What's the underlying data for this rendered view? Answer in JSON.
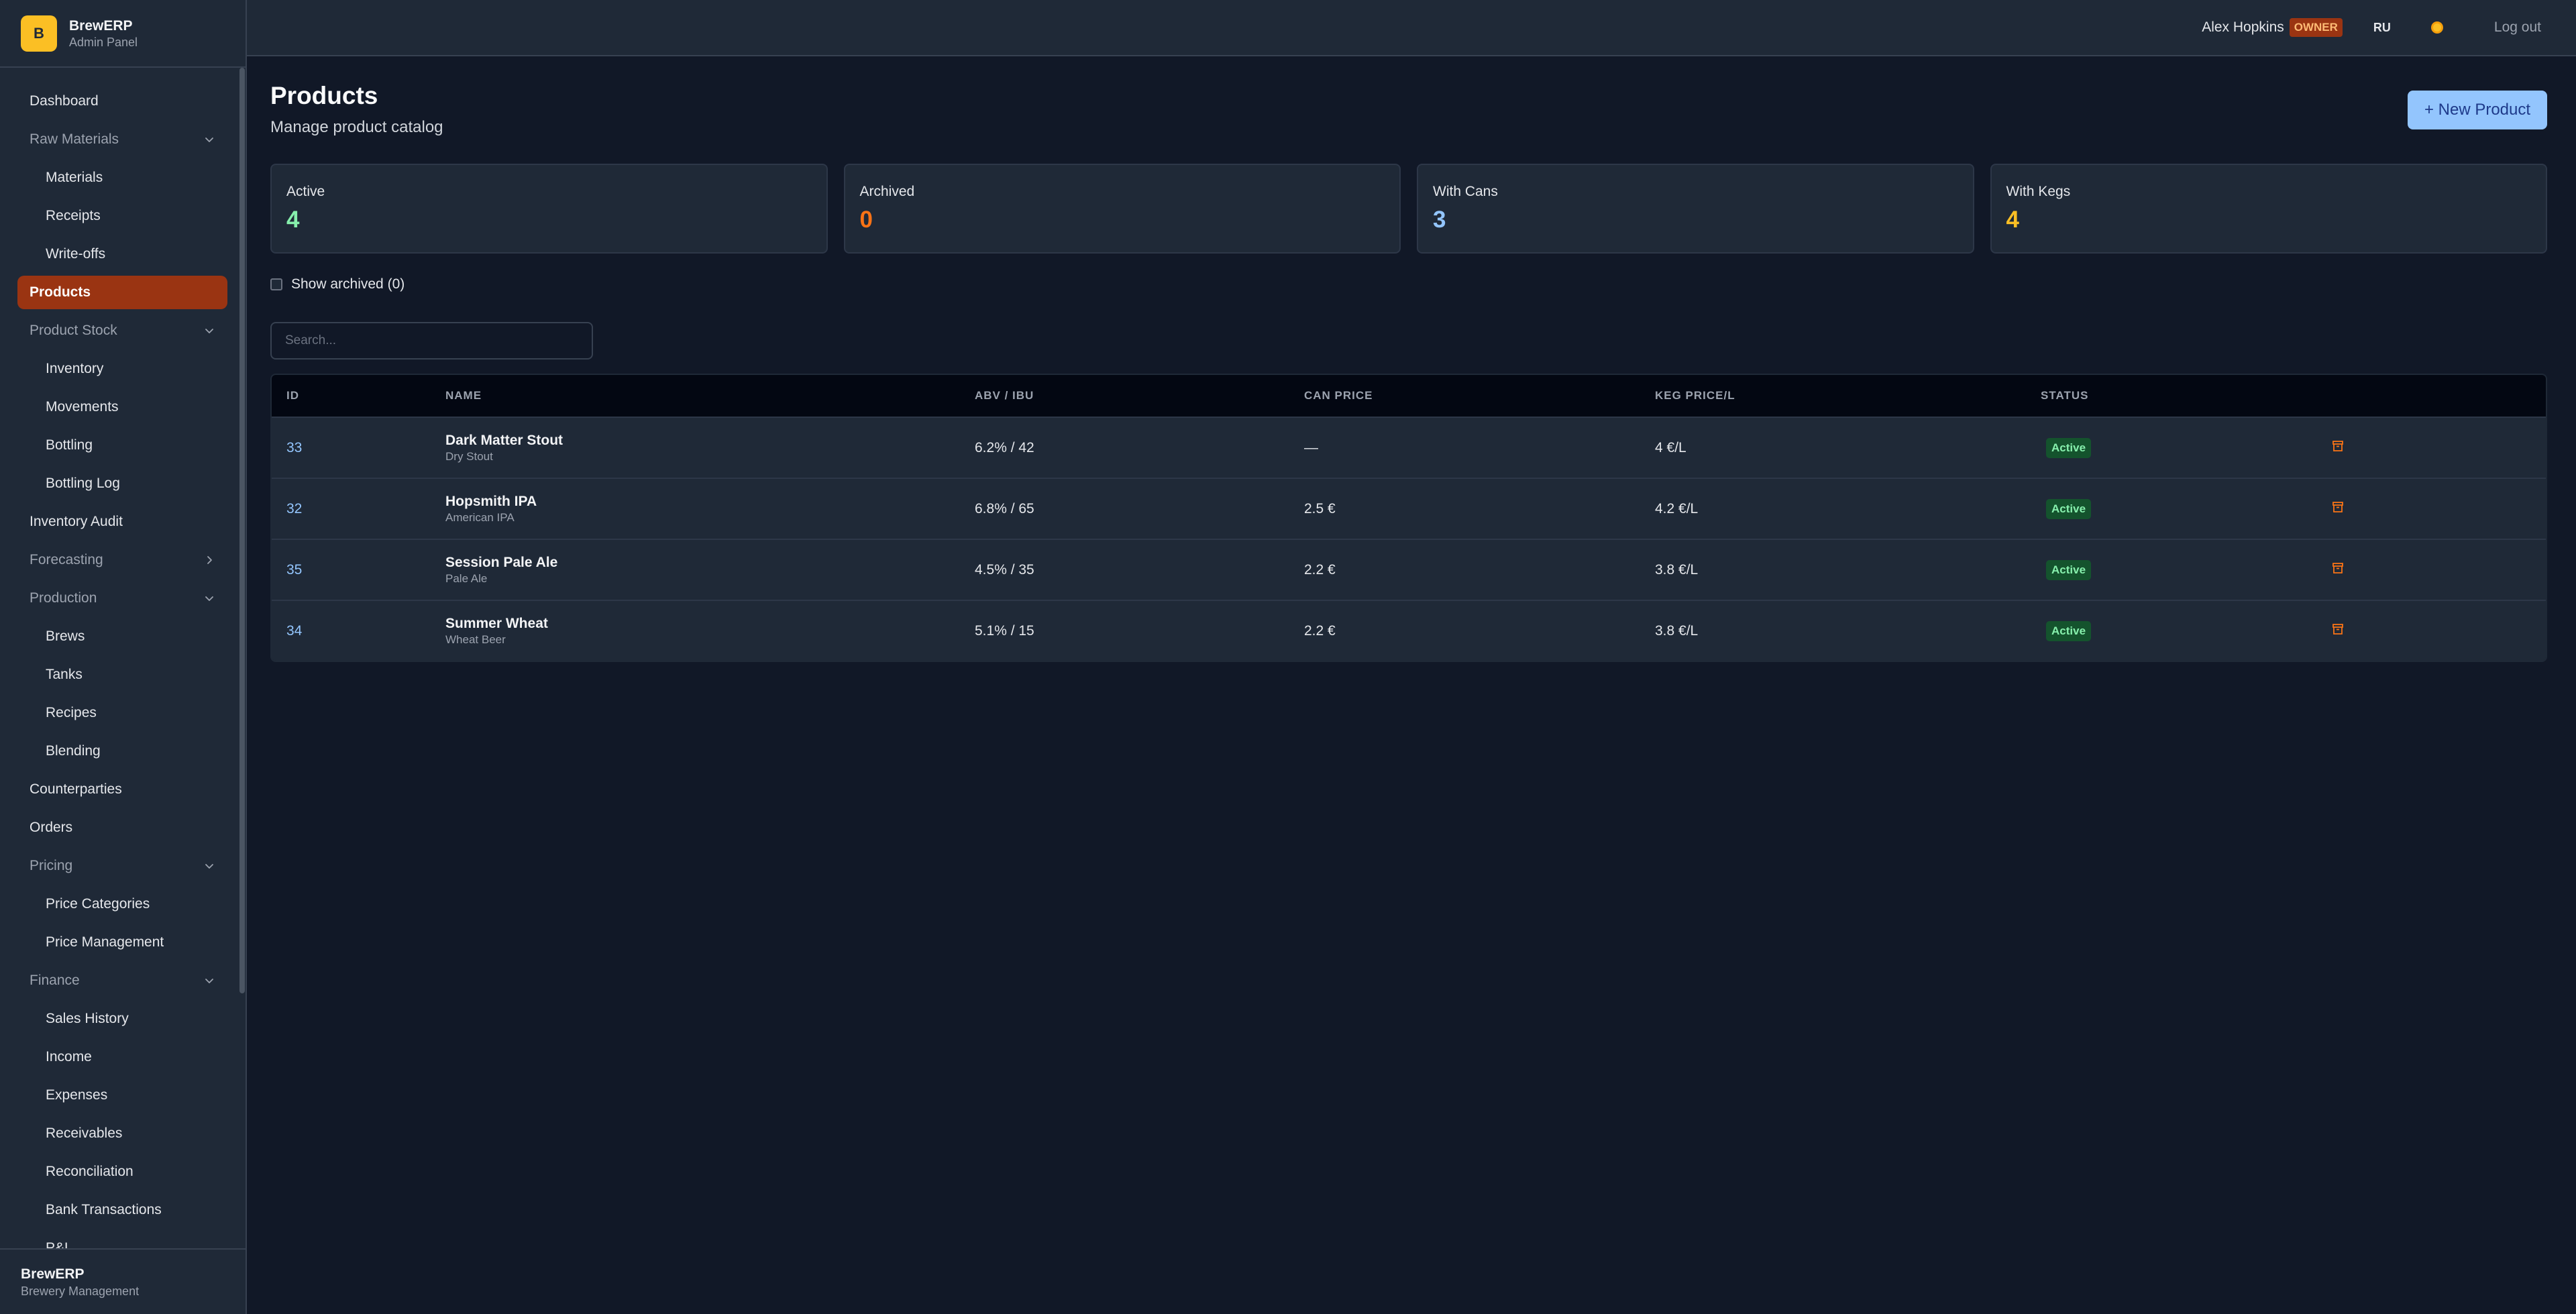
{
  "brand": {
    "initial": "B",
    "name": "BrewERP",
    "subtitle": "Admin Panel"
  },
  "sidebar": {
    "items": [
      {
        "label": "Dashboard",
        "kind": "item"
      },
      {
        "label": "Raw Materials",
        "kind": "group",
        "chevron": "chevron-down-icon"
      },
      {
        "label": "Materials",
        "kind": "sub"
      },
      {
        "label": "Receipts",
        "kind": "sub"
      },
      {
        "label": "Write-offs",
        "kind": "sub"
      },
      {
        "label": "Products",
        "kind": "item",
        "active": true
      },
      {
        "label": "Product Stock",
        "kind": "group",
        "chevron": "chevron-down-icon"
      },
      {
        "label": "Inventory",
        "kind": "sub"
      },
      {
        "label": "Movements",
        "kind": "sub"
      },
      {
        "label": "Bottling",
        "kind": "sub"
      },
      {
        "label": "Bottling Log",
        "kind": "sub"
      },
      {
        "label": "Inventory Audit",
        "kind": "item"
      },
      {
        "label": "Forecasting",
        "kind": "group",
        "chevron": "chevron-right-icon"
      },
      {
        "label": "Production",
        "kind": "group",
        "chevron": "chevron-down-icon"
      },
      {
        "label": "Brews",
        "kind": "sub"
      },
      {
        "label": "Tanks",
        "kind": "sub"
      },
      {
        "label": "Recipes",
        "kind": "sub"
      },
      {
        "label": "Blending",
        "kind": "sub"
      },
      {
        "label": "Counterparties",
        "kind": "item"
      },
      {
        "label": "Orders",
        "kind": "item"
      },
      {
        "label": "Pricing",
        "kind": "group",
        "chevron": "chevron-down-icon"
      },
      {
        "label": "Price Categories",
        "kind": "sub"
      },
      {
        "label": "Price Management",
        "kind": "sub"
      },
      {
        "label": "Finance",
        "kind": "group",
        "chevron": "chevron-down-icon"
      },
      {
        "label": "Sales History",
        "kind": "sub"
      },
      {
        "label": "Income",
        "kind": "sub"
      },
      {
        "label": "Expenses",
        "kind": "sub"
      },
      {
        "label": "Receivables",
        "kind": "sub"
      },
      {
        "label": "Reconciliation",
        "kind": "sub"
      },
      {
        "label": "Bank Transactions",
        "kind": "sub"
      },
      {
        "label": "P&L",
        "kind": "sub"
      }
    ],
    "footer": {
      "title": "BrewERP",
      "subtitle": "Brewery Management"
    }
  },
  "topbar": {
    "user_name": "Alex Hopkins",
    "role": "OWNER",
    "language": "RU",
    "theme_icon": "sun-icon",
    "logout_label": "Log out"
  },
  "page": {
    "title": "Products",
    "subtitle": "Manage product catalog",
    "new_button": "+ New Product"
  },
  "stats": [
    {
      "label": "Active",
      "value": "4",
      "color": "#86efac"
    },
    {
      "label": "Archived",
      "value": "0",
      "color": "#f97316"
    },
    {
      "label": "With Cans",
      "value": "3",
      "color": "#93c5fd"
    },
    {
      "label": "With Kegs",
      "value": "4",
      "color": "#fbbf24"
    }
  ],
  "filters": {
    "show_archived_label": "Show archived (0)",
    "show_archived_checked": false,
    "search_placeholder": "Search...",
    "search_value": ""
  },
  "table": {
    "columns": [
      "ID",
      "NAME",
      "ABV / IBU",
      "CAN PRICE",
      "KEG PRICE/L",
      "STATUS"
    ],
    "rows": [
      {
        "id": "33",
        "name": "Dark Matter Stout",
        "style": "Dry Stout",
        "abv_ibu": "6.2% / 42",
        "can_price": "—",
        "keg_price": "4 €/L",
        "status": "Active"
      },
      {
        "id": "32",
        "name": "Hopsmith IPA",
        "style": "American IPA",
        "abv_ibu": "6.8% / 65",
        "can_price": "2.5 €",
        "keg_price": "4.2 €/L",
        "status": "Active"
      },
      {
        "id": "35",
        "name": "Session Pale Ale",
        "style": "Pale Ale",
        "abv_ibu": "4.5% / 35",
        "can_price": "2.2 €",
        "keg_price": "3.8 €/L",
        "status": "Active"
      },
      {
        "id": "34",
        "name": "Summer Wheat",
        "style": "Wheat Beer",
        "abv_ibu": "5.1% / 15",
        "can_price": "2.2 €",
        "keg_price": "3.8 €/L",
        "status": "Active"
      }
    ],
    "row_action_icon": "archive-icon"
  },
  "colors": {
    "accent_active_nav": "#9a3412",
    "primary_button": "#93c5fd",
    "status_active": "#86efac",
    "archive_icon": "#f97316"
  }
}
